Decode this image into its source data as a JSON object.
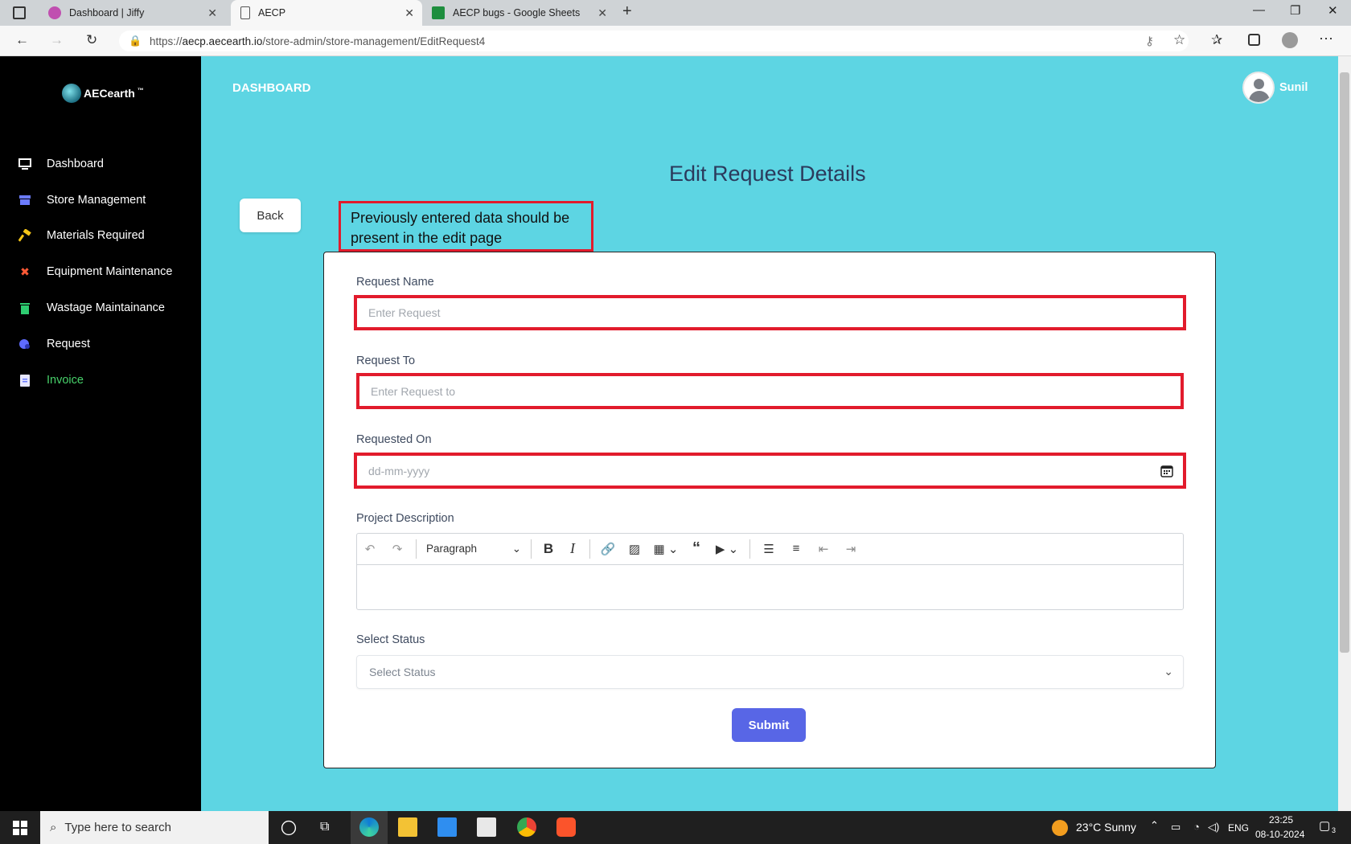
{
  "browser": {
    "tabs": [
      {
        "title": "Dashboard | Jiffy"
      },
      {
        "title": "AECP"
      },
      {
        "title": "AECP bugs - Google Sheets"
      }
    ],
    "url_prefix": "https://",
    "url_host": "aecp.aecearth.io",
    "url_path": "/store-admin/store-management/EditRequest4"
  },
  "sidebar": {
    "logo_text": "AECearth",
    "logo_tm": "™",
    "items": [
      {
        "label": "Dashboard",
        "icon": "monitor-icon",
        "color": "#ffffff"
      },
      {
        "label": "Store Management",
        "icon": "store-icon",
        "color": "#ffffff"
      },
      {
        "label": "Materials Required",
        "icon": "hammer-icon",
        "color": "#ffffff"
      },
      {
        "label": "Equipment Maintenance",
        "icon": "tools-icon",
        "color": "#ffffff"
      },
      {
        "label": "Wastage Maintainance",
        "icon": "trash-icon",
        "color": "#ffffff"
      },
      {
        "label": "Request",
        "icon": "request-icon",
        "color": "#ffffff"
      },
      {
        "label": "Invoice",
        "icon": "document-icon",
        "color": "#47d16a"
      }
    ]
  },
  "header": {
    "title": "DASHBOARD",
    "user_name": "Sunil"
  },
  "page": {
    "title": "Edit Request Details",
    "back_label": "Back",
    "annotation": "Previously entered data should be present in the edit page"
  },
  "form": {
    "request_name": {
      "label": "Request Name",
      "placeholder": "Enter Request"
    },
    "request_to": {
      "label": "Request To",
      "placeholder": "Enter Request to"
    },
    "requested_on": {
      "label": "Requested On",
      "placeholder": "dd-mm-yyyy"
    },
    "project_description": {
      "label": "Project Description",
      "paragraph_style": "Paragraph"
    },
    "status": {
      "label": "Select Status",
      "placeholder": "Select Status"
    },
    "submit_label": "Submit"
  },
  "taskbar": {
    "search_placeholder": "Type here to search",
    "weather": "23°C  Sunny",
    "language": "ENG",
    "time": "23:25",
    "date": "08-10-2024",
    "notification_count": "3"
  },
  "colors": {
    "accent": "#5866e6",
    "background": "#5dd5e3",
    "highlight": "#e21b2c"
  }
}
